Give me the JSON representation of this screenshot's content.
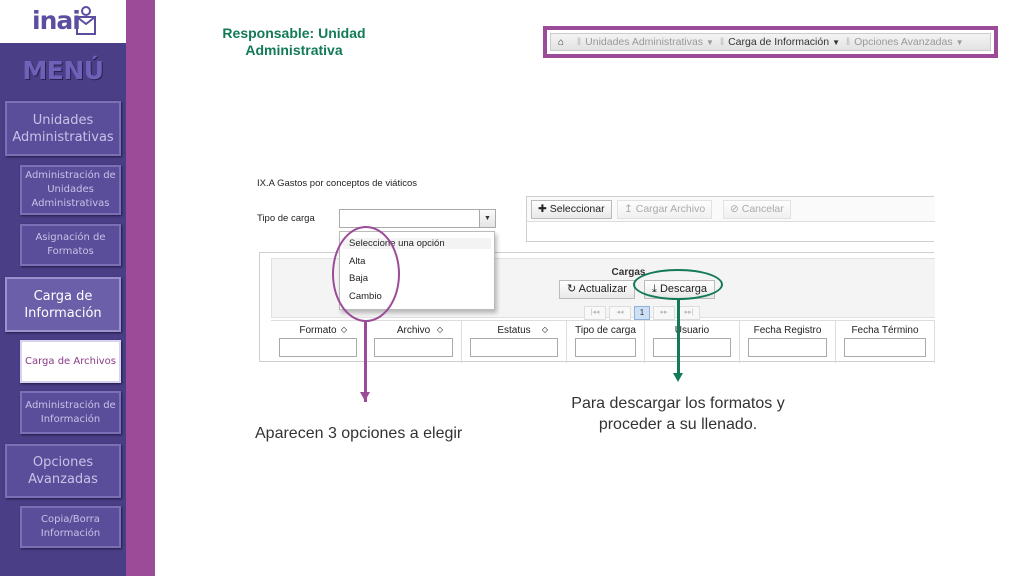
{
  "logo": {
    "text": "inai"
  },
  "menu_title": "MENÚ",
  "sidebar": {
    "items": [
      {
        "label": "Unidades Administrativas",
        "level": "main",
        "active": false
      },
      {
        "label": "Administración de Unidades Administrativas",
        "level": "sub",
        "active": false
      },
      {
        "label": "Asignación de Formatos",
        "level": "sub",
        "active": false
      },
      {
        "label": "Carga de Información",
        "level": "main",
        "active": true
      },
      {
        "label": "Carga de Archivos",
        "level": "sub",
        "active": true
      },
      {
        "label": "Administración de Información",
        "level": "sub",
        "active": false
      },
      {
        "label": "Opciones Avanzadas",
        "level": "main",
        "active": false
      },
      {
        "label": "Copia/Borra Información",
        "level": "sub",
        "active": false
      }
    ]
  },
  "header": {
    "responsable": "Responsable: Unidad Administrativa"
  },
  "breadcrumb": {
    "home_icon": "home-icon",
    "items": [
      {
        "label": "Unidades Administrativas",
        "active": false
      },
      {
        "label": "Carga de Información",
        "active": true
      },
      {
        "label": "Opciones Avanzadas",
        "active": false
      }
    ]
  },
  "form": {
    "section_title": "IX.A Gastos por conceptos de viáticos",
    "tipo_label": "Tipo de carga",
    "tipo_value": "",
    "dropdown_options": [
      "Seleccione una opción",
      "Alta",
      "Baja",
      "Cambio"
    ]
  },
  "toolbar": {
    "seleccionar": "Seleccionar",
    "cargar_archivo": "Cargar Archivo",
    "cancelar": "Cancelar"
  },
  "cargas": {
    "title": "Cargas",
    "actualizar": "Actualizar",
    "descarga": "Descarga",
    "pager": {
      "first": "|◂◂",
      "prev": "◂◂",
      "page": "1",
      "next": "▸▸",
      "last": "▸▸|"
    },
    "columns": [
      "Formato",
      "Archivo",
      "Estatus",
      "Tipo de carga",
      "Usuario",
      "Fecha Registro",
      "Fecha Término"
    ],
    "sortable": [
      true,
      true,
      true,
      false,
      false,
      false,
      false
    ]
  },
  "annotations": {
    "left": "Aparecen 3 opciones a elegir",
    "right": "Para descargar los formatos y proceder a su llenado."
  },
  "colors": {
    "sidebar_bg": "#4a3e86",
    "stripe": "#9b4b97",
    "green": "#137a58",
    "purple": "#9b4b97"
  }
}
